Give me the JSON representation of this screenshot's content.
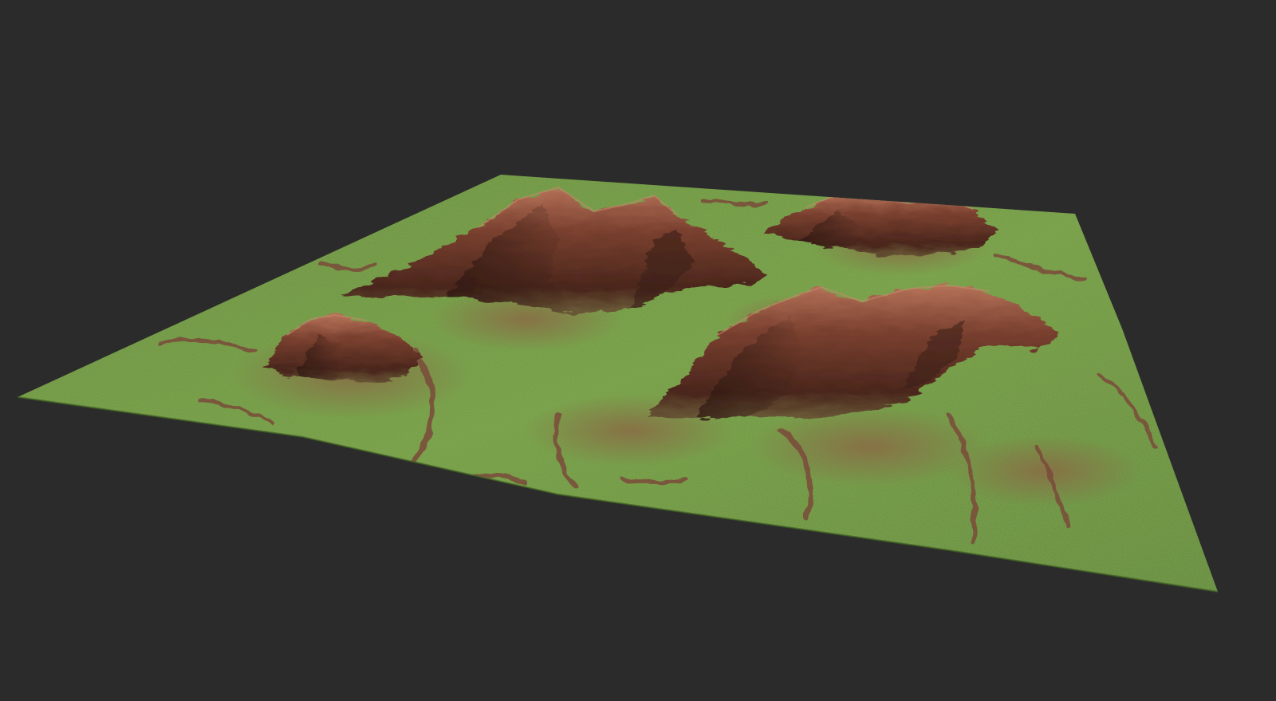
{
  "scene": {
    "background_color": "#2b2b2b",
    "subject": "terrain-mesh",
    "palette": {
      "grass_dark": "#4f7a2c",
      "grass_mid": "#6b9a3a",
      "grass_light": "#8fb04a",
      "rock_dark": "#3a1f18",
      "rock_mid": "#6e3a2a",
      "rock_light": "#b0705a",
      "dirt": "#8a6a45",
      "stream": "#7a4a3a"
    }
  }
}
